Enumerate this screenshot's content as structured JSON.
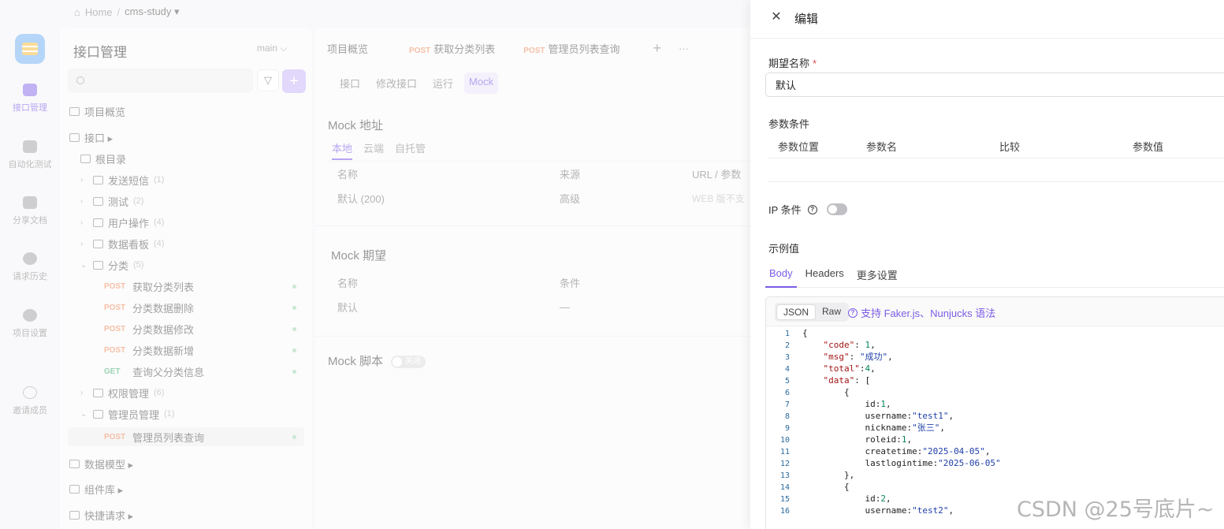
{
  "breadcrumb": {
    "home": "Home",
    "sep": "/",
    "project": "cms-study ▾"
  },
  "rail": [
    {
      "label": "接口管理",
      "active": true
    },
    {
      "label": "自动化测试"
    },
    {
      "label": "分享文档"
    },
    {
      "label": "请求历史"
    },
    {
      "label": "项目设置"
    },
    {
      "label": "邀请成员"
    }
  ],
  "tree": {
    "title": "接口管理",
    "branch": "main ⌵",
    "nodes": [
      {
        "text": "项目概览"
      },
      {
        "text": "接口 ▸"
      },
      {
        "text": "根目录"
      },
      {
        "text": "发送短信",
        "count": "(1)"
      },
      {
        "text": "测试",
        "count": "(2)"
      },
      {
        "text": "用户操作",
        "count": "(4)"
      },
      {
        "text": "数据看板",
        "count": "(4)"
      },
      {
        "text": "分类",
        "count": "(5)"
      },
      {
        "method": "POST",
        "text": "获取分类列表"
      },
      {
        "method": "POST",
        "text": "分类数据删除"
      },
      {
        "method": "POST",
        "text": "分类数据修改"
      },
      {
        "method": "POST",
        "text": "分类数据新增"
      },
      {
        "method": "GET",
        "text": "查询父分类信息"
      },
      {
        "text": "权限管理",
        "count": "(6)"
      },
      {
        "text": "管理员管理",
        "count": "(1)"
      },
      {
        "method": "POST",
        "text": "管理员列表查询"
      },
      {
        "text": "数据模型 ▸"
      },
      {
        "text": "组件库 ▸"
      },
      {
        "text": "快捷请求 ▸"
      }
    ]
  },
  "main": {
    "tabs": [
      {
        "text": "项目概览"
      },
      {
        "method": "POST",
        "text": "获取分类列表"
      },
      {
        "method": "POST",
        "text": "管理员列表查询"
      },
      {
        "text": "+"
      },
      {
        "text": "···"
      }
    ],
    "subtabs": [
      "接口",
      "修改接口",
      "运行",
      "Mock"
    ],
    "mock_addr": {
      "title": "Mock 地址",
      "tabs": [
        "本地",
        "云端",
        "自托管"
      ],
      "cols": [
        "名称",
        "来源",
        "URL / 参数"
      ],
      "row": [
        "默认 (200)",
        "高级",
        "WEB 版不支"
      ]
    },
    "mock_expect": {
      "title": "Mock 期望",
      "cols": [
        "名称",
        "条件"
      ],
      "row": [
        "默认",
        "—"
      ]
    },
    "mock_script": {
      "title": "Mock 脚本",
      "toggle": "关闭"
    }
  },
  "drawer": {
    "close_icon": "close-icon",
    "title": "编辑",
    "name_label": "期望名称",
    "required_mark": "*",
    "name_value": "默认",
    "param_label": "参数条件",
    "param_cols": [
      "参数位置",
      "参数名",
      "比较",
      "参数值"
    ],
    "ip_label": "IP 条件",
    "help": "?",
    "example_label": "示例值",
    "example_tabs": [
      "Body",
      "Headers",
      "更多设置"
    ],
    "format_tabs": [
      "JSON",
      "Raw"
    ],
    "faker_text": "支持 Faker.js、Nunjucks 语法",
    "code_lines": [
      "{",
      "    \"code\": 1,",
      "    \"msg\": \"成功\",",
      "    \"total\":4,",
      "    \"data\": [",
      "        {",
      "            id:1,",
      "            username:\"test1\",",
      "            nickname:\"张三\",",
      "            roleid:1,",
      "            createtime:\"2025-04-05\",",
      "            lastlogintime:\"2025-06-05\"",
      "        },",
      "        {",
      "            id:2,",
      "            username:\"test2\","
    ]
  },
  "watermark": "CSDN @25号底片~"
}
